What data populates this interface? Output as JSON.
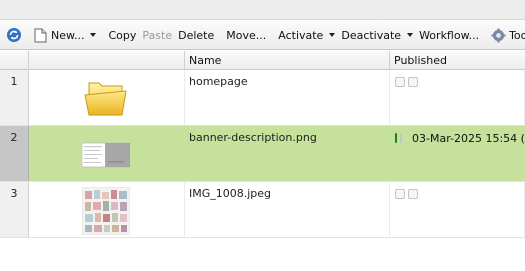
{
  "toolbar": {
    "new_label": "New...",
    "copy_label": "Copy",
    "paste_label": "Paste",
    "delete_label": "Delete",
    "move_label": "Move...",
    "activate_label": "Activate",
    "deactivate_label": "Deactivate",
    "workflow_label": "Workflow...",
    "tools_label": "Tools"
  },
  "columns": {
    "name": "Name",
    "published": "Published"
  },
  "rows": [
    {
      "num": "1",
      "name": "homepage",
      "published_date": "",
      "status": "unpublished",
      "thumb_icon": "folder-icon"
    },
    {
      "num": "2",
      "name": "banner-description.png",
      "published_date": "03-Mar-2025 15:54 (",
      "status": "published",
      "thumb_icon": "image-thumbnail-icon"
    },
    {
      "num": "3",
      "name": "IMG_1008.jpeg",
      "published_date": "",
      "status": "unpublished",
      "thumb_icon": "image-thumbnail-icon"
    }
  ],
  "colors": {
    "selected_row": "#c5e19b",
    "published_green": "#27a82c"
  }
}
